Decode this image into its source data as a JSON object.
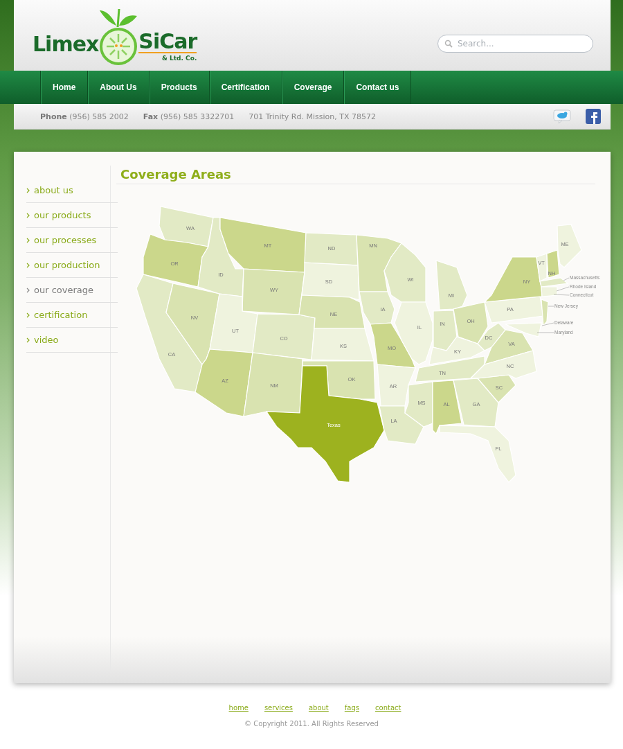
{
  "logo": {
    "left": "Limex",
    "right": "SiCar",
    "sub": "& Ltd. Co."
  },
  "search": {
    "placeholder": "Search..."
  },
  "nav": [
    "Home",
    "About Us",
    "Products",
    "Certification",
    "Coverage",
    "Contact us"
  ],
  "contact": {
    "phone_label": "Phone",
    "phone": "(956) 585 2002",
    "fax_label": "Fax",
    "fax": "(956) 585 3322701",
    "address": "701 Trinity Rd. Mission, TX 78572"
  },
  "sidebar": {
    "items": [
      {
        "label": "about us",
        "selected": false
      },
      {
        "label": "our products",
        "selected": false
      },
      {
        "label": "our processes",
        "selected": false
      },
      {
        "label": "our production",
        "selected": false
      },
      {
        "label": "our coverage",
        "selected": true
      },
      {
        "label": "certification",
        "selected": false
      },
      {
        "label": "video",
        "selected": false
      }
    ]
  },
  "content": {
    "title": "Coverage Areas"
  },
  "map": {
    "states": [
      {
        "label": "WA",
        "color": "#e2eac5"
      },
      {
        "label": "OR",
        "color": "#cbd78b"
      },
      {
        "label": "CA",
        "color": "#e2eac5"
      },
      {
        "label": "NV",
        "color": "#d9e3b0"
      },
      {
        "label": "ID",
        "color": "#e2eac5"
      },
      {
        "label": "MT",
        "color": "#cbd78b"
      },
      {
        "label": "WY",
        "color": "#d9e3b0"
      },
      {
        "label": "UT",
        "color": "#eff3de"
      },
      {
        "label": "CO",
        "color": "#e2eac5"
      },
      {
        "label": "AZ",
        "color": "#cbd78b"
      },
      {
        "label": "NM",
        "color": "#d9e3b0"
      },
      {
        "label": "ND",
        "color": "#e2eac5"
      },
      {
        "label": "SD",
        "color": "#eff3de"
      },
      {
        "label": "NE",
        "color": "#d9e3b0"
      },
      {
        "label": "KS",
        "color": "#eff3de"
      },
      {
        "label": "OK",
        "color": "#d9e3b0"
      },
      {
        "label": "Texas",
        "color": "#9db21f"
      },
      {
        "label": "MN",
        "color": "#d9e3b0"
      },
      {
        "label": "IA",
        "color": "#e2eac5"
      },
      {
        "label": "MO",
        "color": "#cbd78b"
      },
      {
        "label": "AR",
        "color": "#eff3de"
      },
      {
        "label": "LA",
        "color": "#e2eac5"
      },
      {
        "label": "WI",
        "color": "#e2eac5"
      },
      {
        "label": "IL",
        "color": "#eff3de"
      },
      {
        "label": "MI",
        "color": "#e2eac5"
      },
      {
        "label": "IN",
        "color": "#e2eac5"
      },
      {
        "label": "OH",
        "color": "#d9e3b0"
      },
      {
        "label": "KY",
        "color": "#eff3de"
      },
      {
        "label": "TN",
        "color": "#e2eac5"
      },
      {
        "label": "MS",
        "color": "#e2eac5"
      },
      {
        "label": "AL",
        "color": "#cbd78b"
      },
      {
        "label": "GA",
        "color": "#e2eac5"
      },
      {
        "label": "FL",
        "color": "#eff3de"
      },
      {
        "label": "SC",
        "color": "#d9e3b0"
      },
      {
        "label": "VA",
        "color": "#d9e3b0"
      },
      {
        "label": "NC",
        "color": "#eff3de"
      },
      {
        "label": "DC",
        "color": "#e2eac5"
      },
      {
        "label": "PA",
        "color": "#eff3de"
      },
      {
        "label": "NY",
        "color": "#cbd78b"
      },
      {
        "label": "VT",
        "color": "#eff3de"
      },
      {
        "label": "NH",
        "color": "#cbd78b"
      },
      {
        "label": "ME",
        "color": "#eff3de"
      },
      {
        "color": "#e2eac5"
      },
      {
        "color": "#eff3de"
      },
      {
        "color": "#d9e3b0"
      },
      {
        "color": "#eff3de"
      }
    ],
    "callouts": [
      "Massachusetts",
      "Rhode Island",
      "Connecticut",
      "New Jersey",
      "Delaware",
      "Maryland"
    ]
  },
  "footer": {
    "links": [
      "home",
      "services",
      "about",
      "faqs",
      "contact"
    ],
    "copyright": "© Copyright 2011.  All Rights Reserved"
  }
}
